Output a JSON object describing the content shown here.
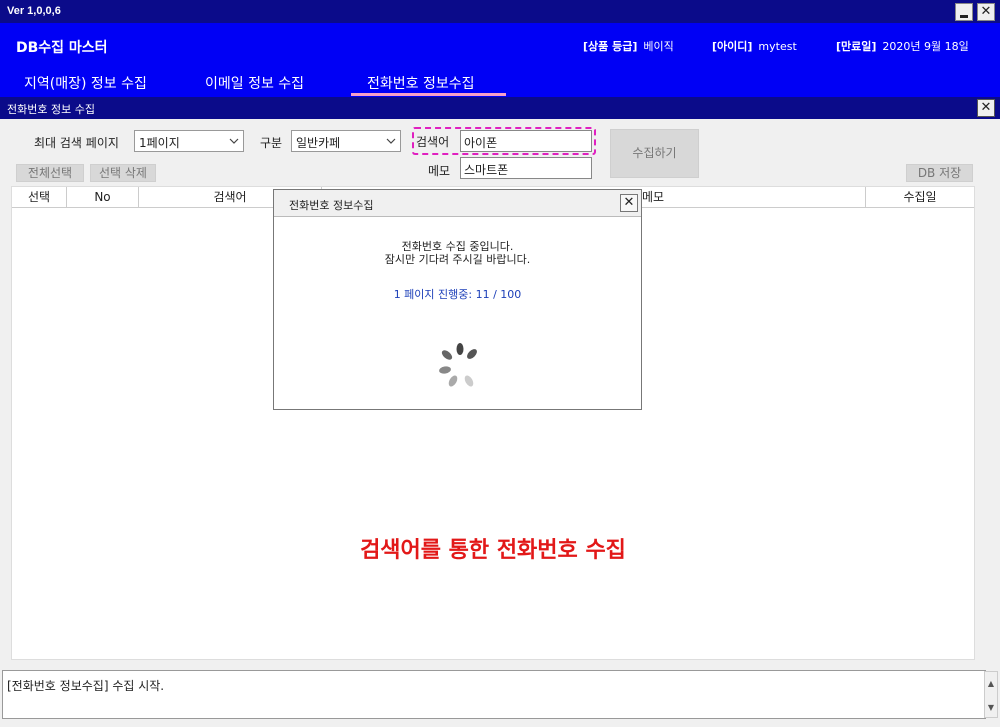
{
  "window": {
    "version": "Ver 1,0,0,6"
  },
  "header": {
    "app_title": "DB수집 마스터",
    "grade_label": "[상품 등급]",
    "grade_value": "베이직",
    "id_label": "[아이디]",
    "id_value": "mytest",
    "expiry_label": "[만료일]",
    "expiry_value": "2020년 9월 18일"
  },
  "nav": {
    "tabs": [
      {
        "label": "지역(매장) 정보 수집"
      },
      {
        "label": "이메일 정보 수집"
      },
      {
        "label": "전화번호 정보수집",
        "active": true
      }
    ]
  },
  "panel": {
    "title": "전화번호 정보 수집",
    "max_pages_label": "최대 검색 페이지",
    "max_pages_value": "1페이지",
    "category_label": "구분",
    "category_value": "일반카페",
    "keyword_label": "검색어",
    "keyword_value": "아이폰",
    "memo_label": "메모",
    "memo_value": "스마트폰",
    "collect_button": "수집하기",
    "select_all_button": "전체선택",
    "delete_selected_button": "선택 삭제",
    "db_save_button": "DB 저장"
  },
  "grid": {
    "columns": [
      "선택",
      "No",
      "검색어",
      "메모",
      "수집일"
    ],
    "rows": [],
    "caption": "검색어를 통한 전화번호 수집"
  },
  "dialog": {
    "title": "전화번호 정보수집",
    "message_line1": "전화번호 수집 중입니다.",
    "message_line2": "잠시만 기다려 주시길 바랍니다.",
    "progress": "1 페이지 진행중: 11 / 100"
  },
  "log": {
    "text": "[전화번호 정보수집] 수집 시작."
  },
  "colors": {
    "titlebar": "#0b0b8a",
    "header": "#0000f5",
    "tab_underline": "#f5a0c8",
    "caption_red": "#e21818",
    "highlight_magenta": "#e020c0",
    "progress_blue": "#1c3fb8"
  }
}
